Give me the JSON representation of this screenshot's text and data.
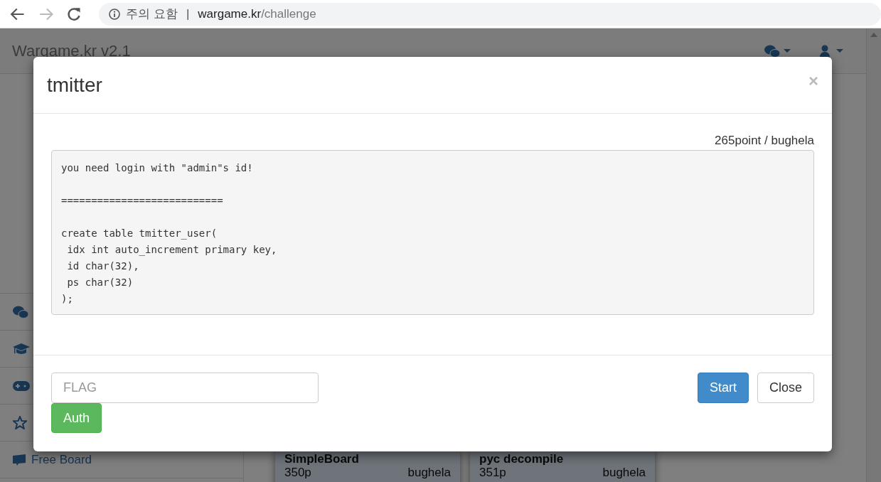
{
  "browser": {
    "security_label": "주의 요함",
    "separator": "|",
    "url_host": "wargame.kr",
    "url_path": "/challenge",
    "forward_disabled": true
  },
  "navbar": {
    "brand": "Wargame.kr v2.1"
  },
  "sidebar": {
    "link": "Free Board"
  },
  "cards": [
    {
      "title": "SimpleBoard",
      "points": "350p",
      "author": "bughela"
    },
    {
      "title": "pyc decompile",
      "points": "351p",
      "author": "bughela"
    }
  ],
  "modal": {
    "title": "tmitter",
    "close": "×",
    "meta": "265point / bughela",
    "code": "you need login with \"admin\"s id!\n\n===========================\n\ncreate table tmitter_user(\n idx int auto_increment primary key,\n id char(32),\n ps char(32)\n);",
    "flag_input": {
      "placeholder": "FLAG"
    },
    "auth_button": "Auth",
    "start_button": "Start",
    "close_button": "Close"
  }
}
